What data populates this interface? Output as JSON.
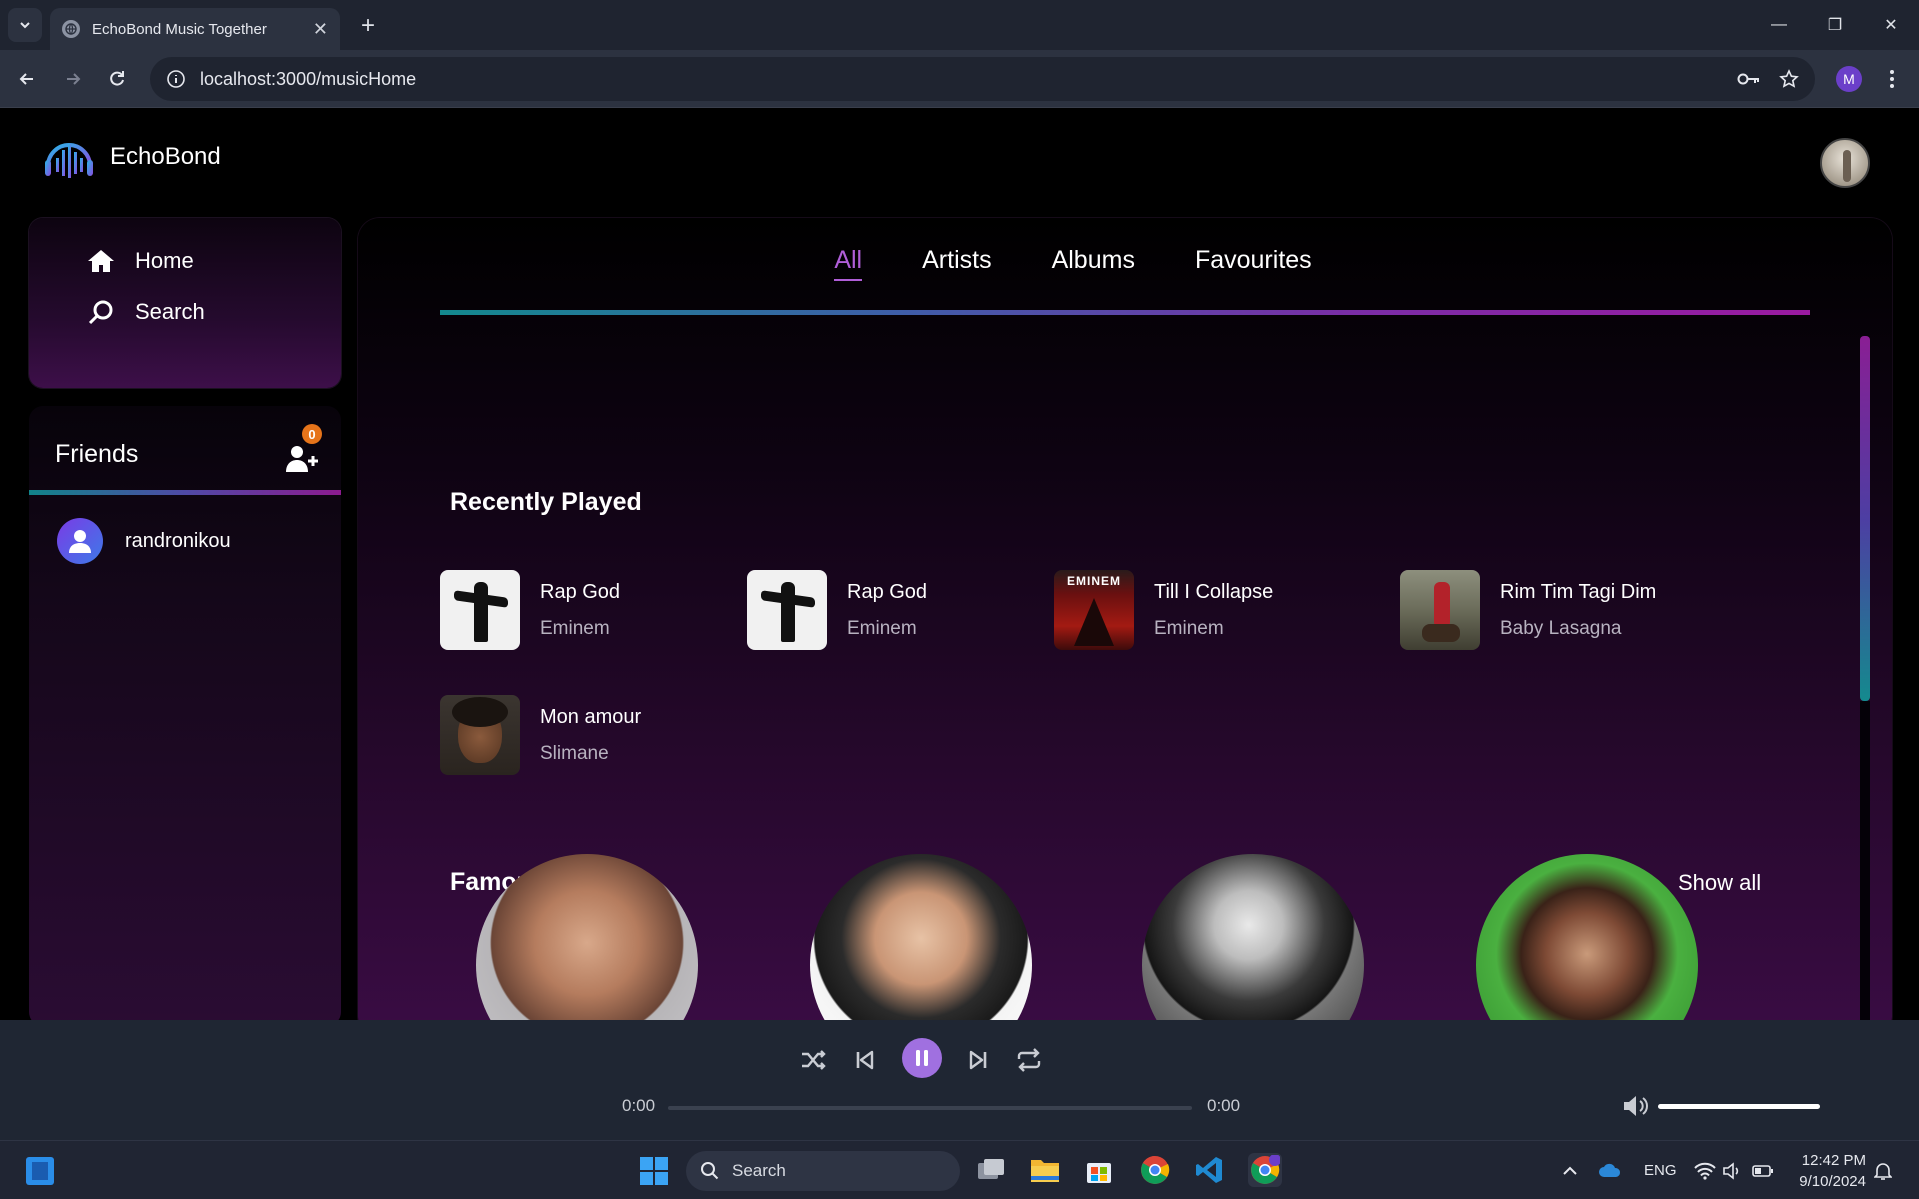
{
  "browser": {
    "tab_title": "EchoBond Music Together",
    "url": "localhost:3000/musicHome",
    "profile_initial": "M"
  },
  "app": {
    "brand": "EchoBond",
    "nav": [
      {
        "label": "Home",
        "icon": "home-icon"
      },
      {
        "label": "Search",
        "icon": "search-icon"
      }
    ],
    "friends": {
      "title": "Friends",
      "request_count": "0",
      "items": [
        {
          "name": "randronikou"
        }
      ]
    },
    "tabs": [
      {
        "label": "All",
        "active": true
      },
      {
        "label": "Artists",
        "active": false
      },
      {
        "label": "Albums",
        "active": false
      },
      {
        "label": "Favourites",
        "active": false
      }
    ],
    "recently_played": {
      "title": "Recently Played",
      "songs": [
        {
          "title": "Rap God",
          "artist": "Eminem"
        },
        {
          "title": "Rap God",
          "artist": "Eminem"
        },
        {
          "title": "Till I Collapse",
          "artist": "Eminem",
          "cover_text": "EMINEM"
        },
        {
          "title": "Rim Tim Tagi Dim",
          "artist": "Baby Lasagna"
        },
        {
          "title": "Mon amour",
          "artist": "Slimane"
        }
      ]
    },
    "famous_artists": {
      "title": "Famous Artists",
      "show_all": "Show all"
    }
  },
  "player": {
    "current_time": "0:00",
    "duration": "0:00",
    "progress_percent": 0,
    "volume_percent": 100,
    "state": "playing"
  },
  "taskbar": {
    "search_placeholder": "Search",
    "language": "ENG",
    "time": "12:42 PM",
    "date": "9/10/2024"
  },
  "colors": {
    "accent": "#a070e0",
    "active_tab": "#b05ed8",
    "gradient_teal": "#13898e",
    "gradient_purple": "#9a1aa0",
    "badge": "#e6741a"
  }
}
